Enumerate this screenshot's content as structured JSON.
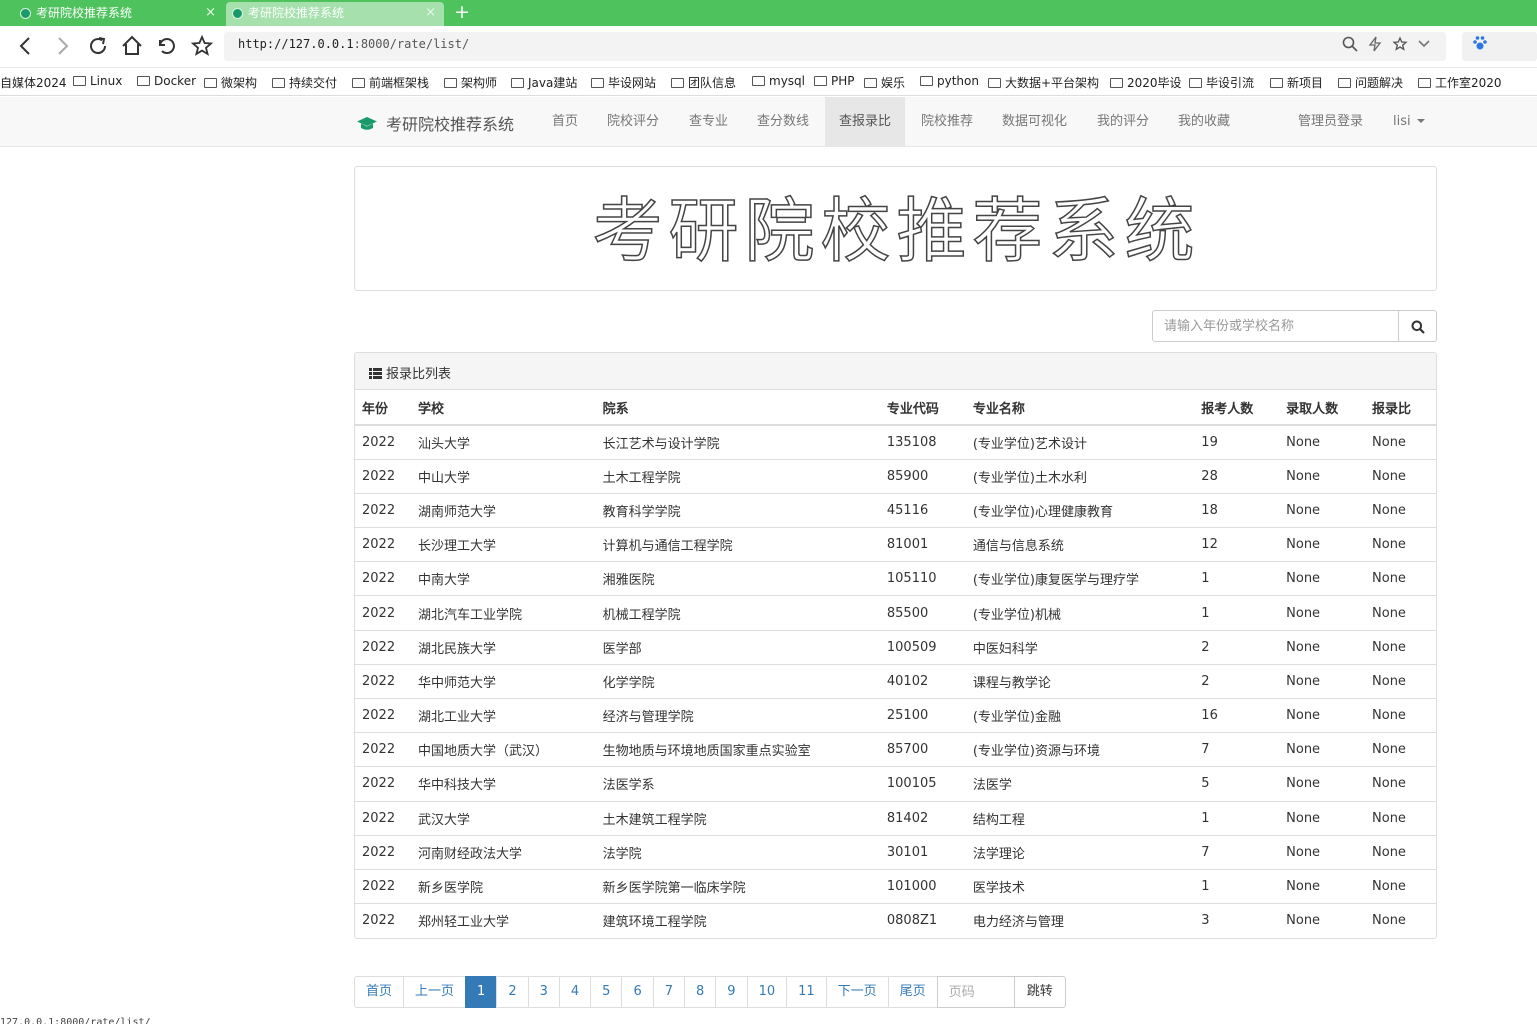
{
  "browser": {
    "tabs": [
      {
        "title": "考研院校推荐系统",
        "close": "×"
      },
      {
        "title": "考研院校推荐系统",
        "close": "×"
      }
    ],
    "new_tab": "+",
    "url_host": "http://127.0.0.1",
    "url_path": ":8000/rate/list/",
    "bookmarks": [
      "自媒体2024",
      "Linux",
      "Docker",
      "微架构",
      "持续交付",
      "前端框架栈",
      "架构师",
      "Java建站",
      "毕设网站",
      "团队信息",
      "mysql",
      "PHP",
      "娱乐",
      "python",
      "大数据+平台架构",
      "2020毕设",
      "毕设引流",
      "新项目",
      "问题解决",
      "工作室2020"
    ],
    "status_url": "127.0.0.1:8000/rate/list/"
  },
  "navbar": {
    "brand": "考研院校推荐系统",
    "links": [
      "首页",
      "院校评分",
      "查专业",
      "查分数线",
      "查报录比",
      "院校推荐",
      "数据可视化",
      "我的评分",
      "我的收藏"
    ],
    "active": "查报录比",
    "admin_login": "管理员登录",
    "user": "lisi"
  },
  "banner": {
    "text": "考研院校推荐系统"
  },
  "search": {
    "placeholder": "请输入年份或学校名称"
  },
  "panel": {
    "title": "报录比列表",
    "columns": [
      "年份",
      "学校",
      "院系",
      "专业代码",
      "专业名称",
      "报考人数",
      "录取人数",
      "报录比"
    ],
    "rows": [
      [
        "2022",
        "汕头大学",
        "长江艺术与设计学院",
        "135108",
        "(专业学位)艺术设计",
        "19",
        "None",
        "None"
      ],
      [
        "2022",
        "中山大学",
        "土木工程学院",
        "85900",
        "(专业学位)土木水利",
        "28",
        "None",
        "None"
      ],
      [
        "2022",
        "湖南师范大学",
        "教育科学学院",
        "45116",
        "(专业学位)心理健康教育",
        "18",
        "None",
        "None"
      ],
      [
        "2022",
        "长沙理工大学",
        "计算机与通信工程学院",
        "81001",
        "通信与信息系统",
        "12",
        "None",
        "None"
      ],
      [
        "2022",
        "中南大学",
        "湘雅医院",
        "105110",
        "(专业学位)康复医学与理疗学",
        "1",
        "None",
        "None"
      ],
      [
        "2022",
        "湖北汽车工业学院",
        "机械工程学院",
        "85500",
        "(专业学位)机械",
        "1",
        "None",
        "None"
      ],
      [
        "2022",
        "湖北民族大学",
        "医学部",
        "100509",
        "中医妇科学",
        "2",
        "None",
        "None"
      ],
      [
        "2022",
        "华中师范大学",
        "化学学院",
        "40102",
        "课程与教学论",
        "2",
        "None",
        "None"
      ],
      [
        "2022",
        "湖北工业大学",
        "经济与管理学院",
        "25100",
        "(专业学位)金融",
        "16",
        "None",
        "None"
      ],
      [
        "2022",
        "中国地质大学（武汉）",
        "生物地质与环境地质国家重点实验室",
        "85700",
        "(专业学位)资源与环境",
        "7",
        "None",
        "None"
      ],
      [
        "2022",
        "华中科技大学",
        "法医学系",
        "100105",
        "法医学",
        "5",
        "None",
        "None"
      ],
      [
        "2022",
        "武汉大学",
        "土木建筑工程学院",
        "81402",
        "结构工程",
        "1",
        "None",
        "None"
      ],
      [
        "2022",
        "河南财经政法大学",
        "法学院",
        "30101",
        "法学理论",
        "7",
        "None",
        "None"
      ],
      [
        "2022",
        "新乡医学院",
        "新乡医学院第一临床学院",
        "101000",
        "医学技术",
        "1",
        "None",
        "None"
      ],
      [
        "2022",
        "郑州轻工业大学",
        "建筑环境工程学院",
        "0808Z1",
        "电力经济与管理",
        "3",
        "None",
        "None"
      ]
    ]
  },
  "pagination": {
    "first": "首页",
    "prev": "上一页",
    "pages": [
      "1",
      "2",
      "3",
      "4",
      "5",
      "6",
      "7",
      "8",
      "9",
      "10",
      "11"
    ],
    "current": "1",
    "next": "下一页",
    "last": "尾页",
    "page_placeholder": "页码",
    "go": "跳转"
  },
  "icons": {
    "back": "arrow-left-icon",
    "forward": "arrow-right-icon",
    "reload": "reload-icon",
    "home": "home-icon",
    "undo": "undo-icon",
    "star": "star-icon",
    "search": "search-icon",
    "lightning": "lightning-icon",
    "chevron": "chevron-down-icon",
    "paw": "paw-icon",
    "folder": "folder-icon",
    "cap": "graduation-cap-icon",
    "list": "list-icon"
  },
  "colors": {
    "tab_strip": "#4ec25d",
    "brand_icon": "#1a9a6a",
    "pagination_active": "#337ab7"
  }
}
